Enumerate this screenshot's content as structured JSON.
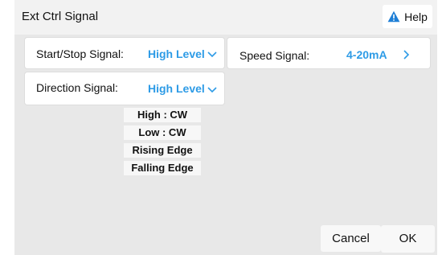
{
  "title": "Ext Ctrl Signal",
  "help_label": "Help",
  "start_stop": {
    "label": "Start/Stop Signal:",
    "value": "High Level"
  },
  "speed": {
    "label": "Speed Signal:",
    "value": "4-20mA"
  },
  "direction": {
    "label": "Direction Signal:",
    "value": "High Level"
  },
  "direction_options": [
    "High : CW",
    "Low : CW",
    "Rising Edge",
    "Falling Edge"
  ],
  "buttons": {
    "cancel": "Cancel",
    "ok": "OK"
  },
  "colors": {
    "accent": "#2d9be6",
    "warning": "#1f7fd6"
  }
}
